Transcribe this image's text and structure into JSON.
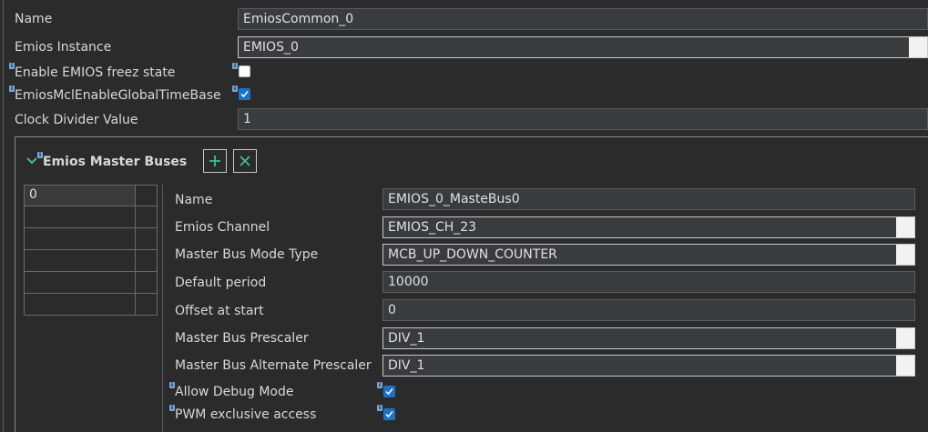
{
  "properties": {
    "name_label": "Name",
    "name_value": "EmiosCommon_0",
    "instance_label": "Emios Instance",
    "instance_value": "EMIOS_0",
    "freeze_label": "Enable EMIOS freez state",
    "freeze_checked": false,
    "global_timebase_label": "EmiosMclEnableGlobalTimeBase",
    "global_timebase_checked": true,
    "clock_divider_label": "Clock Divider Value",
    "clock_divider_value": "1"
  },
  "master_buses": {
    "title": "Emios Master Buses",
    "add_icon": "plus-icon",
    "remove_icon": "close-icon",
    "list": [
      "0"
    ],
    "detail": {
      "name_label": "Name",
      "name_value": "EMIOS_0_MasteBus0",
      "channel_label": "Emios Channel",
      "channel_value": "EMIOS_CH_23",
      "mode_label": "Master Bus Mode Type",
      "mode_value": "MCB_UP_DOWN_COUNTER",
      "period_label": "Default period",
      "period_value": "10000",
      "offset_label": "Offset at start",
      "offset_value": "0",
      "prescaler_label": "Master Bus Prescaler",
      "prescaler_value": "DIV_1",
      "alt_prescaler_label": "Master Bus Alternate Prescaler",
      "alt_prescaler_value": "DIV_1",
      "debug_label": "Allow Debug Mode",
      "debug_checked": true,
      "pwm_label": "PWM exclusive access",
      "pwm_checked": true
    }
  },
  "colors": {
    "background": "#2b2b2b",
    "field": "#393c3f",
    "checkbox_accent": "#1a73c8",
    "button_icon": "#3fbf8f"
  }
}
